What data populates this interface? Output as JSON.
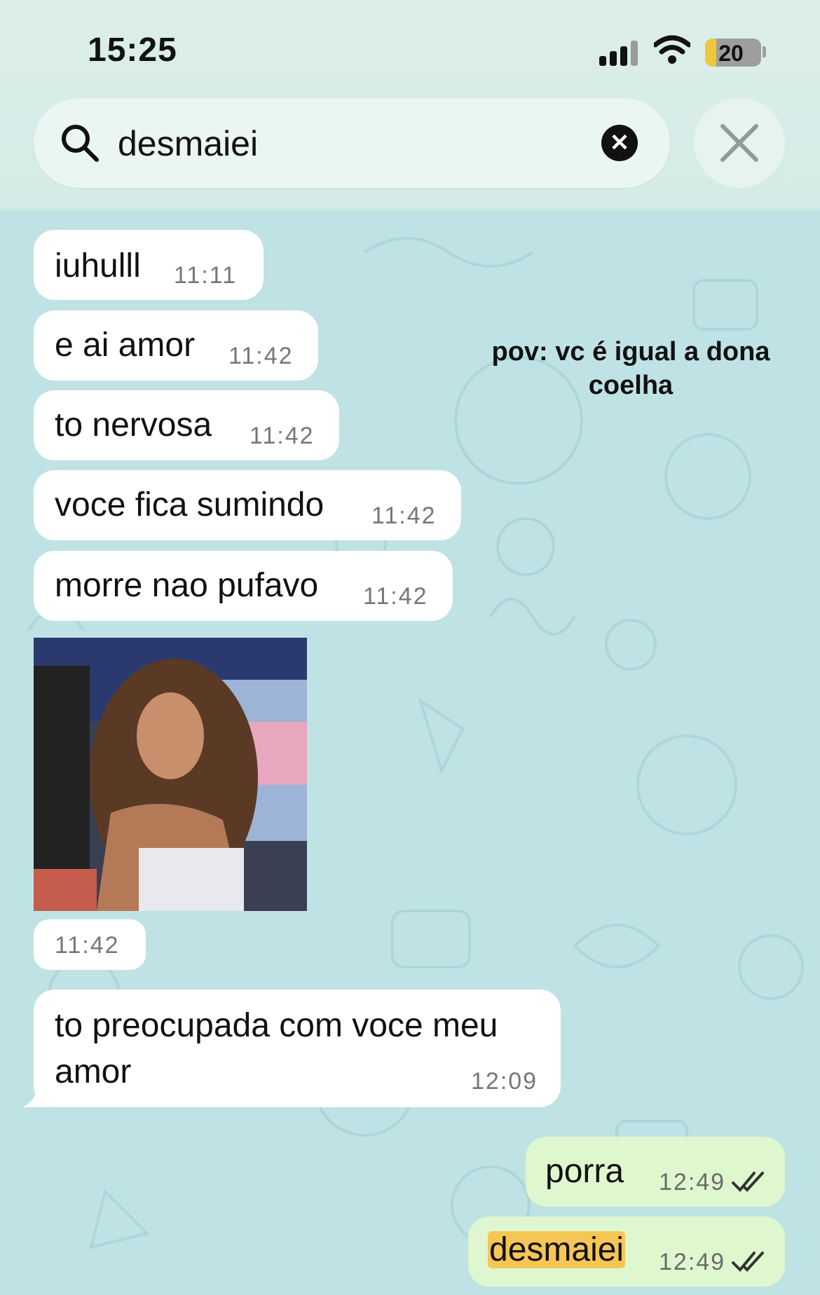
{
  "status_bar": {
    "time": "15:25",
    "battery": "20",
    "battery_level": 0.2,
    "icons": [
      "cellular-signal-icon",
      "wifi-icon",
      "battery-icon"
    ]
  },
  "search": {
    "query": "desmaiei",
    "icons": [
      "search-icon",
      "clear-icon",
      "close-icon"
    ]
  },
  "overlay_caption": "pov: vc é igual a dona coelha",
  "messages": [
    {
      "text": "iuhulll",
      "time": "11:11",
      "direction": "incoming"
    },
    {
      "text": "e ai amor",
      "time": "11:42",
      "direction": "incoming"
    },
    {
      "text": "to nervosa",
      "time": "11:42",
      "direction": "incoming"
    },
    {
      "text": "voce fica sumindo",
      "time": "11:42",
      "direction": "incoming"
    },
    {
      "text": "morre nao pufavo",
      "time": "11:42",
      "direction": "incoming"
    },
    {
      "text": "",
      "time": "11:42",
      "direction": "incoming",
      "type": "photo"
    },
    {
      "text_line1": "to preocupada com voce meu",
      "text_line2": "amor",
      "time": "12:09",
      "direction": "incoming"
    },
    {
      "text": "porra",
      "time": "12:49",
      "direction": "outgoing",
      "status": "read"
    },
    {
      "text": "desmaiei",
      "time": "12:49",
      "direction": "outgoing",
      "status": "read",
      "highlighted": true
    }
  ],
  "colors": {
    "wallpaper": "#bfe2e5",
    "incoming_bubble": "#ffffff",
    "outgoing_bubble": "#dff7cf",
    "search_highlight": "#f6c655"
  }
}
